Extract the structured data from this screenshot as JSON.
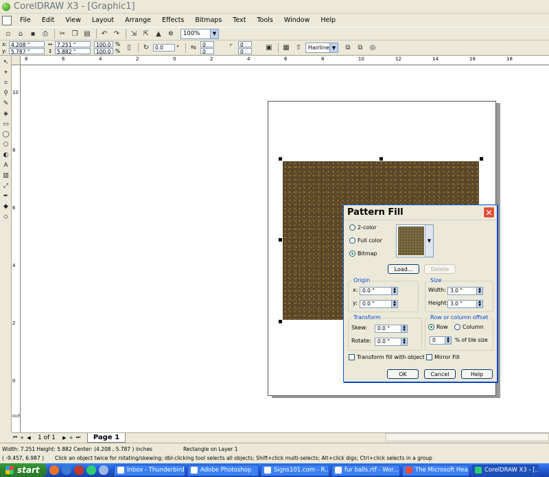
{
  "app": {
    "title": "CorelDRAW X3 - [Graphic1]"
  },
  "menu": [
    "File",
    "Edit",
    "View",
    "Layout",
    "Arrange",
    "Effects",
    "Bitmaps",
    "Text",
    "Tools",
    "Window",
    "Help"
  ],
  "toolbar": {
    "zoom": "100%"
  },
  "propbar": {
    "x": "4.208 \"",
    "y": "5.787 \"",
    "w": "7.251 \"",
    "h": "5.882 \"",
    "scale_w": "100.0",
    "scale_h": "100.0",
    "pct": "%",
    "rotation": "0.0",
    "deg": "°",
    "c1": "0",
    "c2": "0",
    "c3": "0",
    "c4": "0",
    "outline": "Hairline"
  },
  "rulers": {
    "h_ticks": [
      "8",
      "6",
      "4",
      "2",
      "0",
      "2",
      "4",
      "6",
      "8",
      "10",
      "12",
      "14",
      "16",
      "18"
    ],
    "v_ticks": [
      "10",
      "8",
      "6",
      "4",
      "2",
      "0"
    ],
    "units": "inches"
  },
  "dialog": {
    "title": "Pattern Fill",
    "close": "✕",
    "modes": [
      "2-color",
      "Full color",
      "Bitmap"
    ],
    "selected_mode": "Bitmap",
    "load_label": "Load...",
    "delete_label": "Delete",
    "origin": {
      "title": "Origin",
      "x_label": "x:",
      "x_value": "0.0 \"",
      "y_label": "y:",
      "y_value": "0.0 \""
    },
    "size": {
      "title": "Size",
      "width_label": "Width:",
      "width_value": "3.0 \"",
      "height_label": "Height:",
      "height_value": "3.0 \""
    },
    "transform": {
      "title": "Transform",
      "skew_label": "Skew:",
      "skew_value": "0.0 °",
      "rotate_label": "Rotate:",
      "rotate_value": "0.0 °"
    },
    "offset": {
      "title": "Row or column offset",
      "row": "Row",
      "column": "Column",
      "value": "0",
      "unit": "% of tile size"
    },
    "transform_fill_label": "Transform fill with object",
    "mirror_fill_label": "Mirror Fill",
    "ok": "OK",
    "cancel": "Cancel",
    "help": "Help"
  },
  "pagebar": {
    "counter": "1 of 1",
    "tab": "Page 1",
    "nav_first": "⏮",
    "nav_prev": "◀",
    "nav_next": "▶",
    "nav_last": "⏭",
    "add_before": "+",
    "add_after": "+"
  },
  "status": {
    "dimensions": "Width: 7.251  Height: 5.882  Center: (4.208 , 5.787 )  inches",
    "object": "Rectangle on Layer 1",
    "cursor": "( -9.457, 6.987 )",
    "hint": "Click an object twice for rotating/skewing; dbl-clicking tool selects all objects; Shift+click multi-selects; Alt+click digs; Ctrl+click selects in a group"
  },
  "taskbar": {
    "start": "start",
    "tasks": [
      "Inbox - Thunderbird",
      "Adobe Photoshop",
      "Signs101.com - R...",
      "fur balls.rtf - Wor...",
      "The Microsoft Hea...",
      "CorelDRAW X3 - [..."
    ]
  },
  "colors": {
    "accent": "#0054e3",
    "rect_fill": "#5b462a",
    "speckle": "#b89a3a"
  }
}
